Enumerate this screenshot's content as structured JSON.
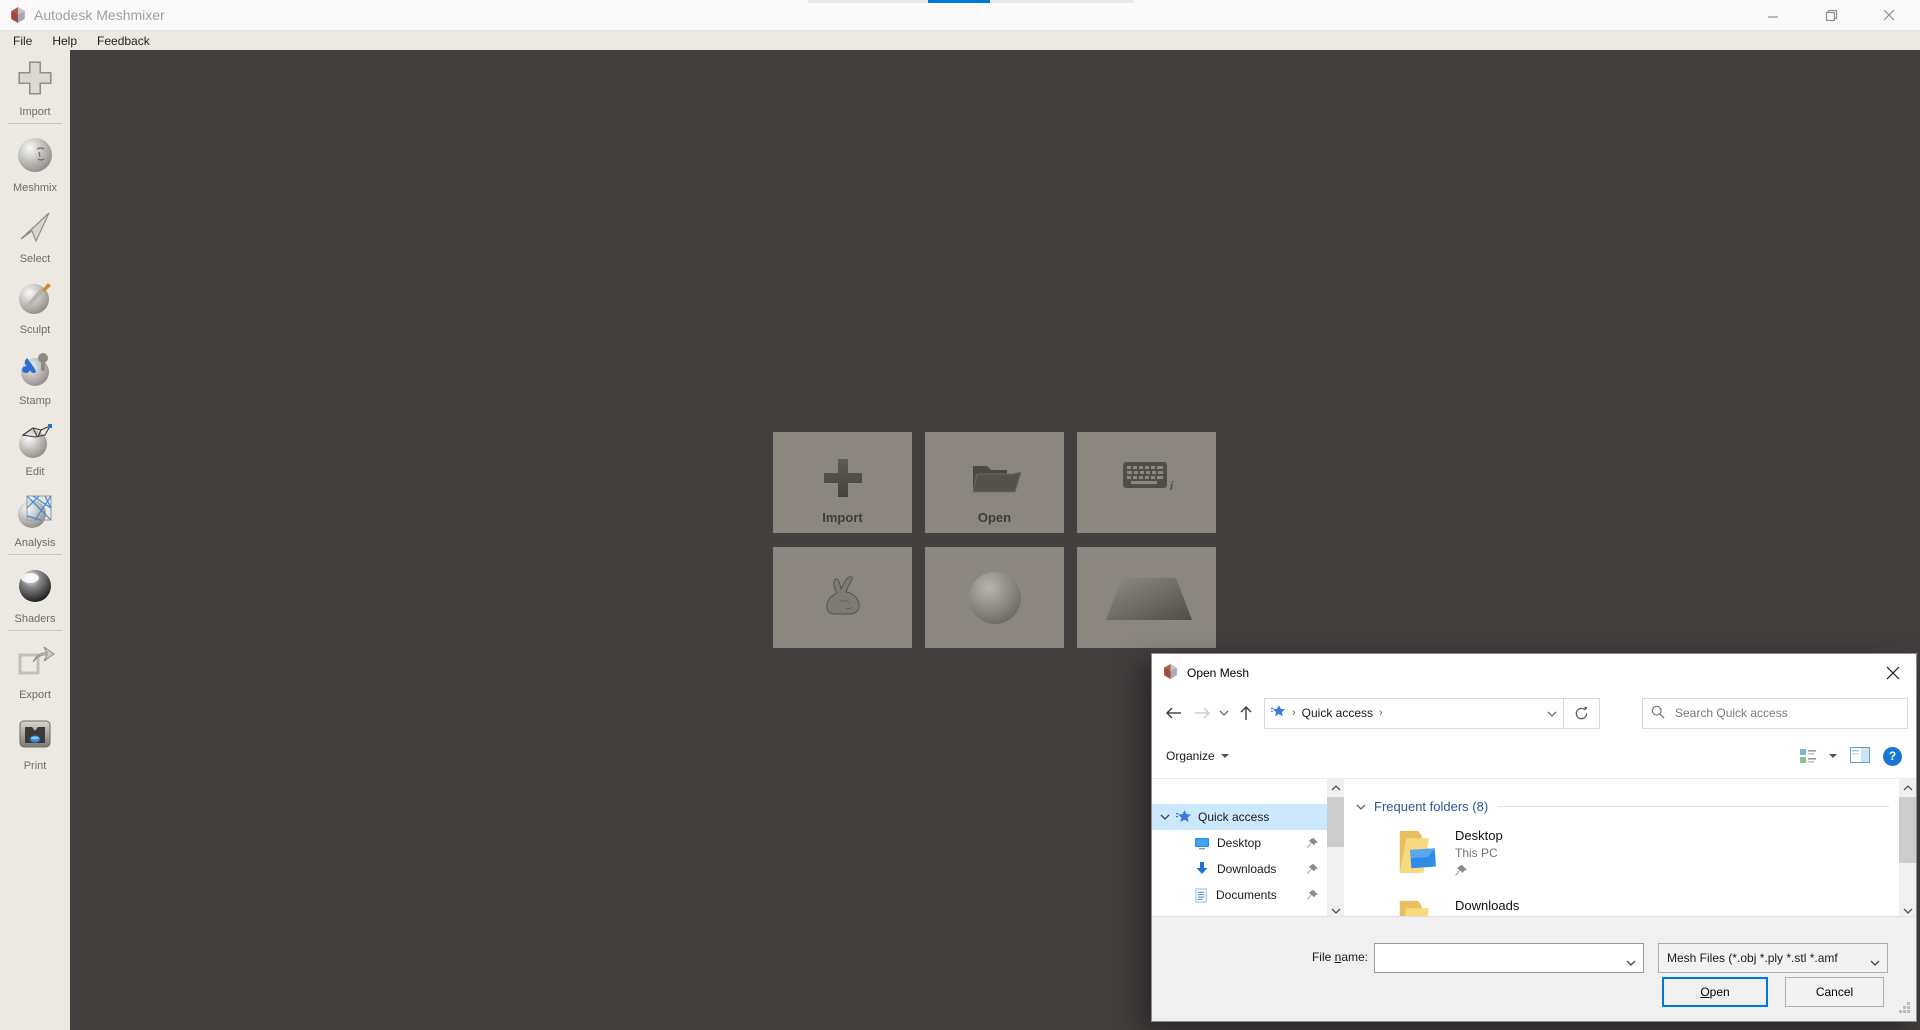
{
  "app": {
    "title": "Autodesk Meshmixer",
    "menu": {
      "items": [
        "File",
        "Help",
        "Feedback"
      ]
    }
  },
  "sidebar": {
    "items": [
      {
        "label": "Import"
      },
      {
        "label": "Meshmix"
      },
      {
        "label": "Select"
      },
      {
        "label": "Sculpt"
      },
      {
        "label": "Stamp"
      },
      {
        "label": "Edit"
      },
      {
        "label": "Analysis"
      },
      {
        "label": "Shaders"
      },
      {
        "label": "Export"
      },
      {
        "label": "Print"
      }
    ]
  },
  "canvas": {
    "tiles": [
      {
        "label": "Import",
        "icon": "plus"
      },
      {
        "label": "Open",
        "icon": "folder"
      },
      {
        "label": "",
        "icon": "keyboard",
        "shortcut_hint": "i"
      },
      {
        "label": "",
        "icon": "bunny"
      },
      {
        "label": "",
        "icon": "sphere"
      },
      {
        "label": "",
        "icon": "plane"
      }
    ]
  },
  "dialog": {
    "title": "Open Mesh",
    "nav": {
      "breadcrumb_root": "Quick access",
      "search_placeholder": "Search Quick access"
    },
    "toolbar": {
      "organize_label": "Organize",
      "help_glyph": "?"
    },
    "tree": {
      "items": [
        {
          "label": "Quick access",
          "selected": true
        },
        {
          "label": "Desktop",
          "pinned": true
        },
        {
          "label": "Downloads",
          "pinned": true
        },
        {
          "label": "Documents",
          "pinned": true
        }
      ]
    },
    "files": {
      "group_header": "Frequent folders (8)",
      "items": [
        {
          "name": "Desktop",
          "location": "This PC",
          "pinned": true
        },
        {
          "name": "Downloads"
        }
      ]
    },
    "footer": {
      "file_name_label_prefix": "File ",
      "file_name_label_mnemonic": "n",
      "file_name_label_suffix": "ame:",
      "file_name_value": "",
      "file_type": "Mesh Files (*.obj *.ply *.stl *.amf",
      "open_mnemonic": "O",
      "open_rest": "pen",
      "cancel_label": "Cancel"
    }
  },
  "colors": {
    "accent": "#0078d7",
    "canvas_bg": "#423f3e",
    "tile_bg": "#8b8680",
    "sidebar_bg": "#ece9e3",
    "selection": "#cce8ff",
    "group_header_text": "#2b5797"
  }
}
